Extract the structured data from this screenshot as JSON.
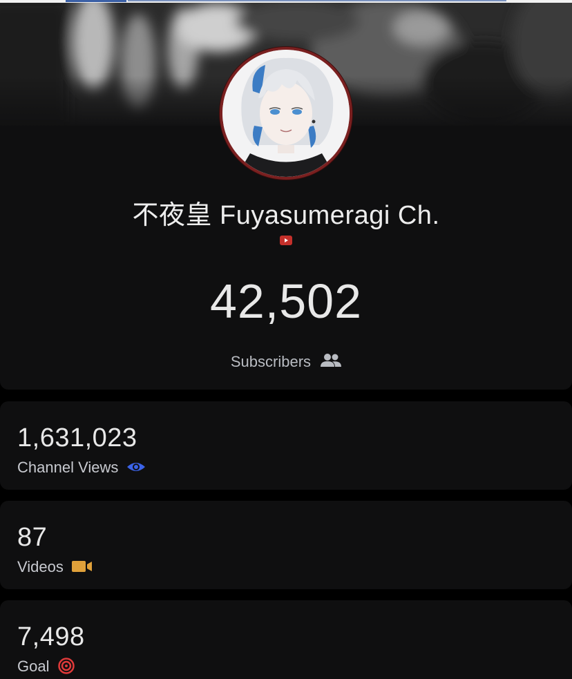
{
  "channel": {
    "name": "不夜皇 Fuyasumeragi Ch.",
    "platform_icon": "youtube-icon"
  },
  "subscribers": {
    "count": "42,502",
    "label": "Subscribers",
    "icon": "users-icon"
  },
  "stats": [
    {
      "value": "1,631,023",
      "label": "Channel Views",
      "icon": "eye-icon",
      "icon_color": "#3b63e8"
    },
    {
      "value": "87",
      "label": "Videos",
      "icon": "video-camera-icon",
      "icon_color": "#e0a13a"
    },
    {
      "value": "7,498",
      "label": "Goal",
      "icon": "target-icon",
      "icon_color": "#e03a3a"
    }
  ],
  "colors": {
    "background": "#000000",
    "card": "#0f0f10",
    "avatar_ring": "#7a2020",
    "youtube_red": "#c4302b"
  }
}
